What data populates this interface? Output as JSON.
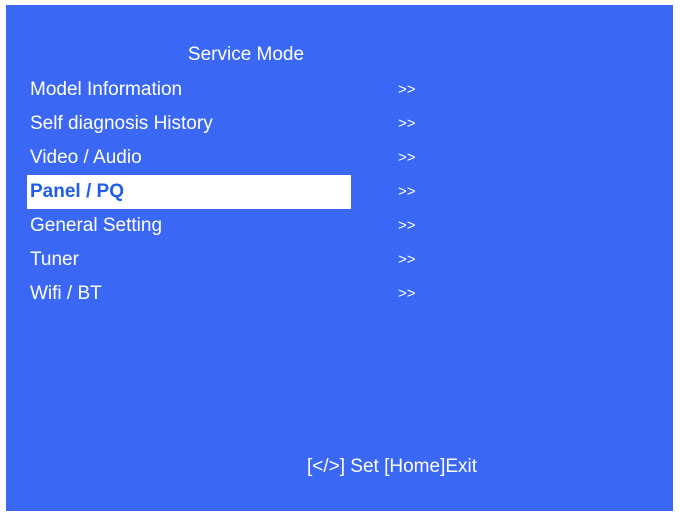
{
  "title": "Service Mode",
  "menu": [
    {
      "label": "Model Information",
      "arrow": ">>",
      "selected": false
    },
    {
      "label": "Self diagnosis History",
      "arrow": ">>",
      "selected": false
    },
    {
      "label": "Video / Audio",
      "arrow": ">>",
      "selected": false
    },
    {
      "label": "Panel / PQ",
      "arrow": ">>",
      "selected": true
    },
    {
      "label": "General Setting",
      "arrow": ">>",
      "selected": false
    },
    {
      "label": "Tuner",
      "arrow": ">>",
      "selected": false
    },
    {
      "label": "Wifi / BT",
      "arrow": ">>",
      "selected": false
    }
  ],
  "footer": "[</>] Set [Home]Exit",
  "colors": {
    "background": "#3a67f3",
    "text": "#ffffff",
    "selected_bg": "#ffffff",
    "selected_text": "#1e5fe8"
  }
}
